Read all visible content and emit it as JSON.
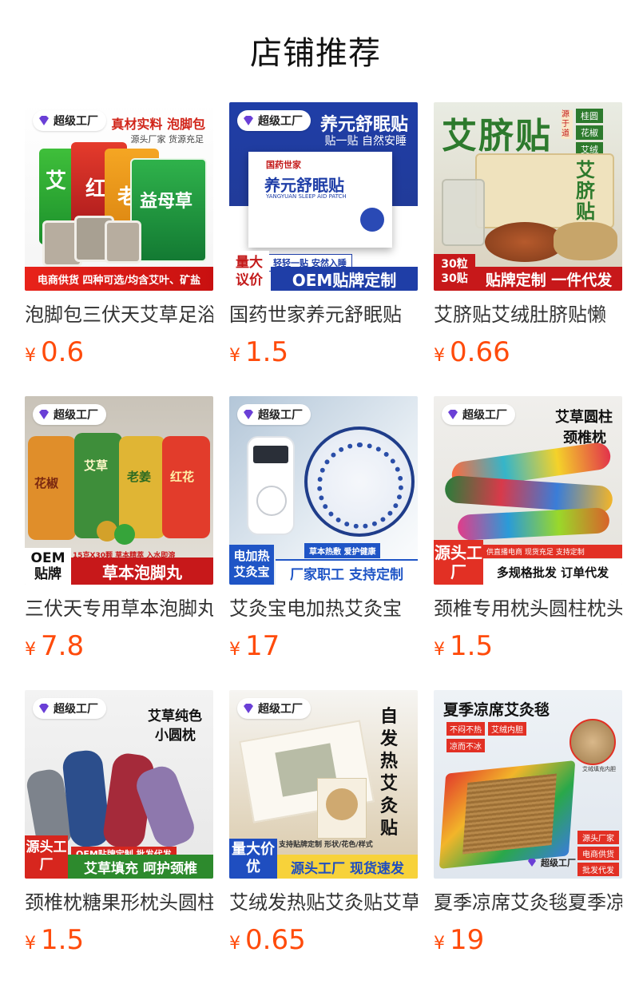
{
  "header": {
    "title": "店铺推荐"
  },
  "currency_symbol": "¥",
  "badge_label": "超级工厂",
  "colors": {
    "price": "#ff4b0b",
    "title": "#111111"
  },
  "products": [
    {
      "name": "泡脚包三伏天艾草足浴",
      "price": "0.6",
      "img": {
        "headline": "真材实料 泡脚包",
        "sub": "源头厂家 货源充足",
        "bag_labels": [
          "艾",
          "红",
          "老",
          "益母草"
        ],
        "banner": "电商供货 四种可选/均含艾叶、矿盐"
      }
    },
    {
      "name": "国药世家养元舒眠贴",
      "price": "1.5",
      "img": {
        "headline": "养元舒眠贴",
        "sub": "贴一贴 自然安睡",
        "box_brand": "国药世家",
        "box_title": "养元舒眠贴",
        "box_en": "YANGYUAN SLEEP AID PATCH",
        "tag": "轻轻一贴 安然入睡",
        "left_label": "量大议价",
        "banner": "OEM贴牌定制"
      }
    },
    {
      "name": "艾脐贴艾绒肚脐贴懒",
      "price": "0.66",
      "img": {
        "headline": "艾脐贴",
        "side_tags": [
          "桂圆",
          "花椒",
          "艾绒"
        ],
        "vertical": "源于道",
        "left_label": "30粒30贴",
        "banner": "贴牌定制 一件代发"
      }
    },
    {
      "name": "三伏天专用草本泡脚丸",
      "price": "7.8",
      "img": {
        "jar_labels": [
          "花椒",
          "艾草",
          "老姜",
          "红花"
        ],
        "sub": "15克X30颗 草本精萃 入水即溶",
        "left_label": "OEM贴牌",
        "banner": "草本泡脚丸"
      }
    },
    {
      "name": "艾灸宝电加热艾灸宝",
      "price": "17",
      "img": {
        "tag": "草本热敷 爱护健康",
        "left_label": "电加热艾灸宝",
        "banner": "厂家职工 支持定制"
      }
    },
    {
      "name": "颈椎专用枕头圆柱枕头",
      "price": "1.5",
      "img": {
        "headline": "艾草圆柱",
        "headline2": "颈椎枕",
        "sub": "供直播电商 现货充足 支持定制",
        "left_label": "源头工厂",
        "banner": "多规格批发 订单代发"
      }
    },
    {
      "name": "颈椎枕糖果形枕头圆柱",
      "price": "1.5",
      "img": {
        "headline": "艾草纯色",
        "headline2": "小圆枕",
        "tag": "OEM贴牌定制 批发代发",
        "left_label": "源头工厂",
        "banner": "艾草填充 呵护颈椎"
      }
    },
    {
      "name": "艾绒发热贴艾灸贴艾草",
      "price": "0.65",
      "img": {
        "vertical": "自发热艾灸贴",
        "tag": "支持贴牌定制 形状/花色/样式",
        "left_label": "量大价优",
        "banner": "源头工厂 现货速发"
      }
    },
    {
      "name": "夏季凉席艾灸毯夏季凉",
      "price": "19",
      "img": {
        "headline": "夏季凉席艾灸毯",
        "chips": [
          "不闷不热",
          "艾绒内胆",
          "凉而不冰"
        ],
        "inset_caption": "艾绒填充内胆",
        "side_tags": [
          "源头厂家",
          "电商供货",
          "批发代发"
        ]
      }
    }
  ]
}
